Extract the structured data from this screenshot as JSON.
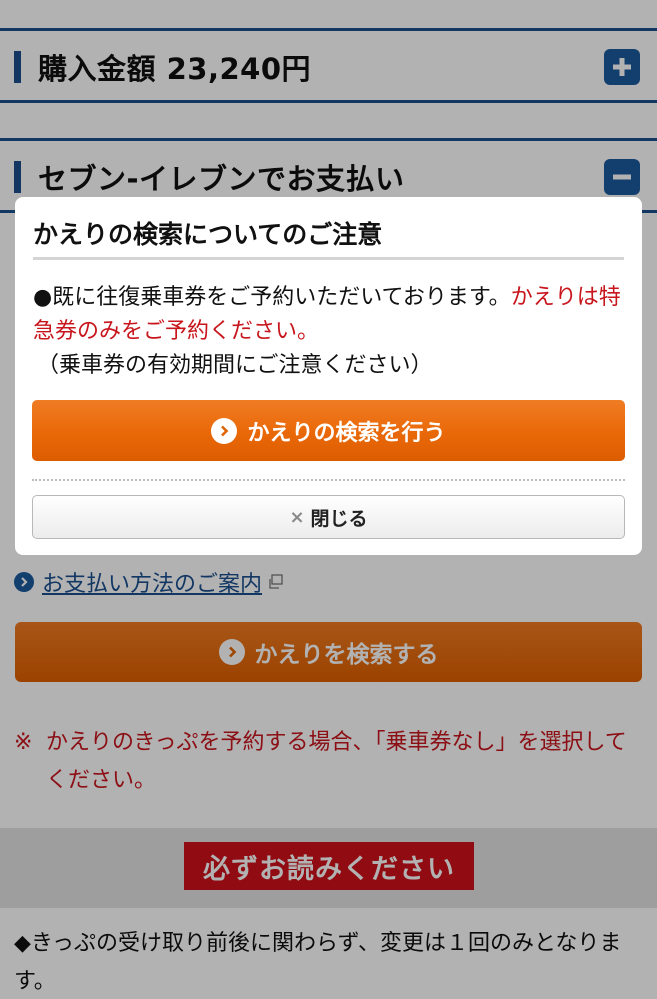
{
  "purchase": {
    "title": "購入金額 23,240円",
    "toggle_icon": "plus-icon"
  },
  "payment": {
    "title": "セブン-イレブンでお支払い",
    "toggle_icon": "minus-icon"
  },
  "payment_guide_link": "お支払い方法のご案内",
  "search_return_button": "かえりを検索する",
  "return_note": {
    "mark": "※",
    "text": "かえりのきっぷを予約する場合、「乗車券なし」を選択してください。"
  },
  "must_read_label": "必ずお読みください",
  "policy_text": "◆きっぷの受け取り前後に関わらず、変更は１回のみとなります。",
  "modal": {
    "title": "かえりの検索についてのご注意",
    "body_black": "●既に往復乗車券をご予約いただいております。",
    "body_red": "かえりは特急券のみをご予約ください。",
    "body_paren": "（乗車券の有効期間にご注意ください）",
    "primary_button": "かえりの検索を行う",
    "close_x": "×",
    "close_button": "閉じる"
  },
  "colors": {
    "accent_blue": "#1a4f8f",
    "accent_orange": "#e86a0c",
    "alert_red": "#c8161d"
  }
}
